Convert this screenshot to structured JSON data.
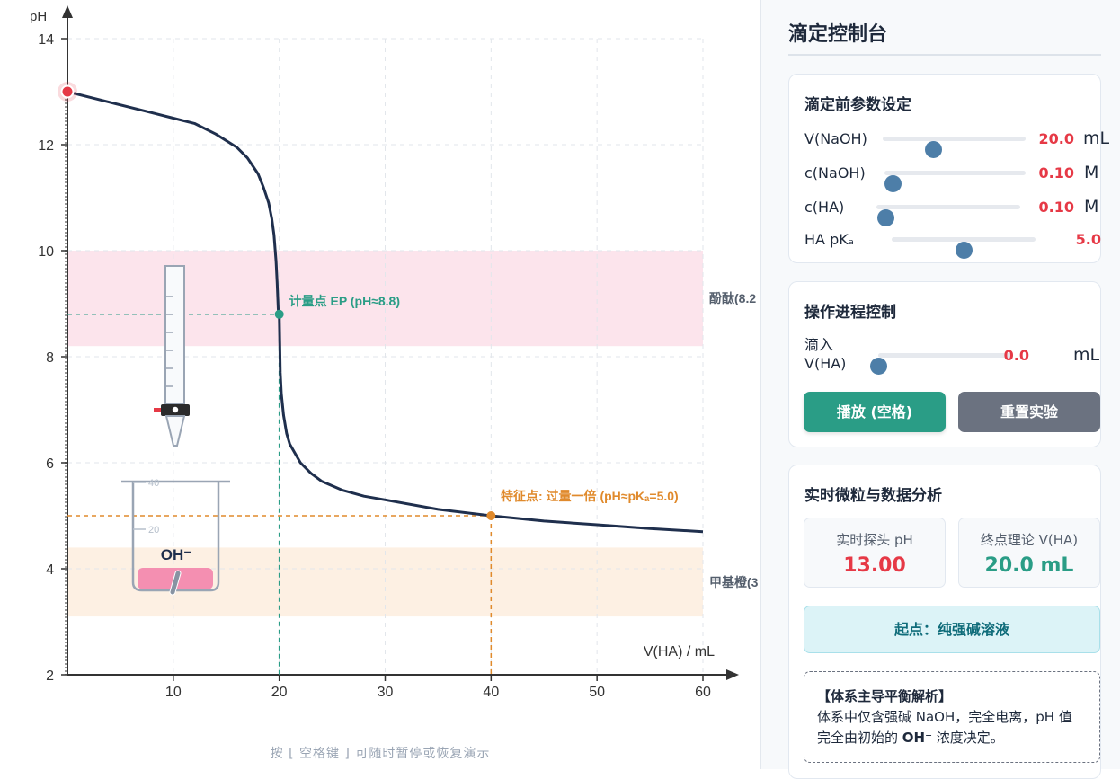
{
  "chart_data": {
    "type": "line",
    "title": "",
    "xlabel": "V(HA) / mL",
    "ylabel": "pH",
    "xlim": [
      0,
      60
    ],
    "ylim": [
      2,
      14.5
    ],
    "x_ticks": [
      "10",
      "20",
      "30",
      "40",
      "50",
      "60"
    ],
    "y_ticks": [
      "2",
      "4",
      "6",
      "8",
      "10",
      "12",
      "14"
    ],
    "grid": true,
    "series": [
      {
        "x": [
          0,
          2,
          4,
          6,
          8,
          10,
          12,
          14,
          16,
          17,
          18,
          18.5,
          19,
          19.3,
          19.5,
          19.7,
          19.8,
          19.9,
          19.95,
          20,
          20.05,
          20.1,
          20.2,
          20.4,
          20.7,
          21,
          22,
          23,
          24,
          26,
          28,
          30,
          35,
          40,
          45,
          50,
          55,
          60
        ],
        "y": [
          13.0,
          12.9,
          12.8,
          12.7,
          12.6,
          12.5,
          12.4,
          12.2,
          11.95,
          11.75,
          11.45,
          11.2,
          10.9,
          10.6,
          10.3,
          9.8,
          9.4,
          8.9,
          8.8,
          8.8,
          8.2,
          7.7,
          7.3,
          6.9,
          6.55,
          6.35,
          6.0,
          5.8,
          5.65,
          5.48,
          5.37,
          5.3,
          5.12,
          5.0,
          4.9,
          4.83,
          4.76,
          4.7
        ]
      }
    ],
    "bands": [
      {
        "label": "酚酞(8.2",
        "from": 8.2,
        "to": 10.0,
        "color": "#fce4ec"
      },
      {
        "label": "甲基橙(3",
        "from": 3.1,
        "to": 4.4,
        "color": "#fdf0e3"
      }
    ],
    "annotations": [
      {
        "text": "计量点 EP (pH≈8.8)",
        "x": 20,
        "y": 8.8,
        "color": "#2a9d86"
      },
      {
        "text": "特征点: 过量一倍 (pH≈pKₐ=5.0)",
        "x": 40,
        "y": 5.0,
        "color": "#e08a2c"
      }
    ],
    "current_point": {
      "x": 0,
      "y": 13.0
    }
  },
  "apparatus": {
    "beaker_marks": [
      "40",
      "20"
    ],
    "ion_label": "OH⁻"
  },
  "hint": "按 [ 空格键 ] 可随时暂停或恢复演示",
  "panel": {
    "title": "滴定控制台",
    "params": {
      "title": "滴定前参数设定",
      "rows": [
        {
          "label": "V(NaOH)",
          "value": "20.0",
          "unit": "mL",
          "fraction": 0.35
        },
        {
          "label": "c(NaOH)",
          "value": "0.10",
          "unit": "M",
          "fraction": 0.06
        },
        {
          "label": "c(HA)",
          "value": "0.10",
          "unit": "M",
          "fraction": 0.06
        },
        {
          "label": "HA pKₐ",
          "value": "5.0",
          "unit": "",
          "fraction": 0.5
        }
      ]
    },
    "progress": {
      "title": "操作进程控制",
      "label_line1": "滴入",
      "label_line2": "V(HA)",
      "value": "0.0",
      "unit": "mL",
      "fraction": 0.0,
      "play_label": "播放 (空格)",
      "reset_label": "重置实验"
    },
    "analysis": {
      "title": "实时微粒与数据分析",
      "ph_label": "实时探头 pH",
      "ph_value": "13.00",
      "ph_color": "#e63946",
      "endpoint_label": "终点理论 V(HA)",
      "endpoint_value": "20.0 mL",
      "endpoint_color": "#2a9d86",
      "phase": "起点：纯强碱溶液",
      "equilibrium_title": "【体系主导平衡解析】",
      "equilibrium_line1": "体系中仅含强碱 NaOH，完全电离，pH 值",
      "equilibrium_line2_a": "完全由初始的 ",
      "equilibrium_line2_b": "OH⁻",
      "equilibrium_line2_c": " 浓度决定。"
    }
  }
}
